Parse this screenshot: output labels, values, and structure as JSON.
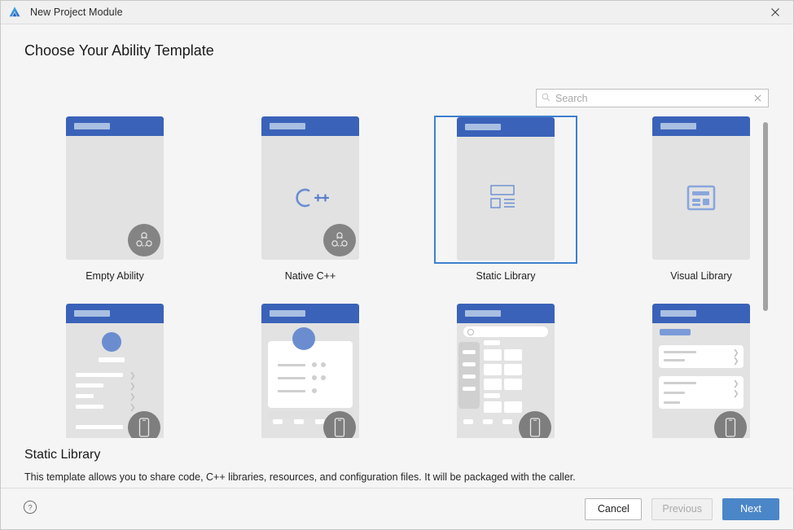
{
  "window": {
    "title": "New Project Module",
    "app_icon": "harmony-logo-icon",
    "close_icon": "close-icon"
  },
  "page": {
    "heading": "Choose Your Ability Template"
  },
  "search": {
    "placeholder": "Search",
    "value": "",
    "icon": "search-icon",
    "clear_icon": "clear-icon"
  },
  "templates": [
    {
      "label": "Empty Ability",
      "art": "empty",
      "badge": "ability",
      "selected": false
    },
    {
      "label": "Native C++",
      "art": "cpp",
      "badge": "ability",
      "selected": false
    },
    {
      "label": "Static Library",
      "art": "static",
      "badge": "none",
      "selected": true
    },
    {
      "label": "Visual Library",
      "art": "visual",
      "badge": "none",
      "selected": false
    },
    {
      "label": "",
      "art": "profile",
      "badge": "phone",
      "selected": false
    },
    {
      "label": "",
      "art": "card",
      "badge": "phone",
      "selected": false
    },
    {
      "label": "",
      "art": "catalog",
      "badge": "phone",
      "selected": false
    },
    {
      "label": "",
      "art": "list",
      "badge": "phone",
      "selected": false
    }
  ],
  "description": {
    "title": "Static Library",
    "text": "This template allows you to share code, C++ libraries, resources, and configuration files. It will be packaged with the caller."
  },
  "footer": {
    "help_icon": "help-circle-icon",
    "cancel": "Cancel",
    "previous": "Previous",
    "next": "Next"
  },
  "colors": {
    "accent_blue": "#4a86c8",
    "thumb_header_blue": "#3a62b8",
    "selection_border": "#3f7fcf",
    "dialog_bg": "#f5f5f5"
  }
}
